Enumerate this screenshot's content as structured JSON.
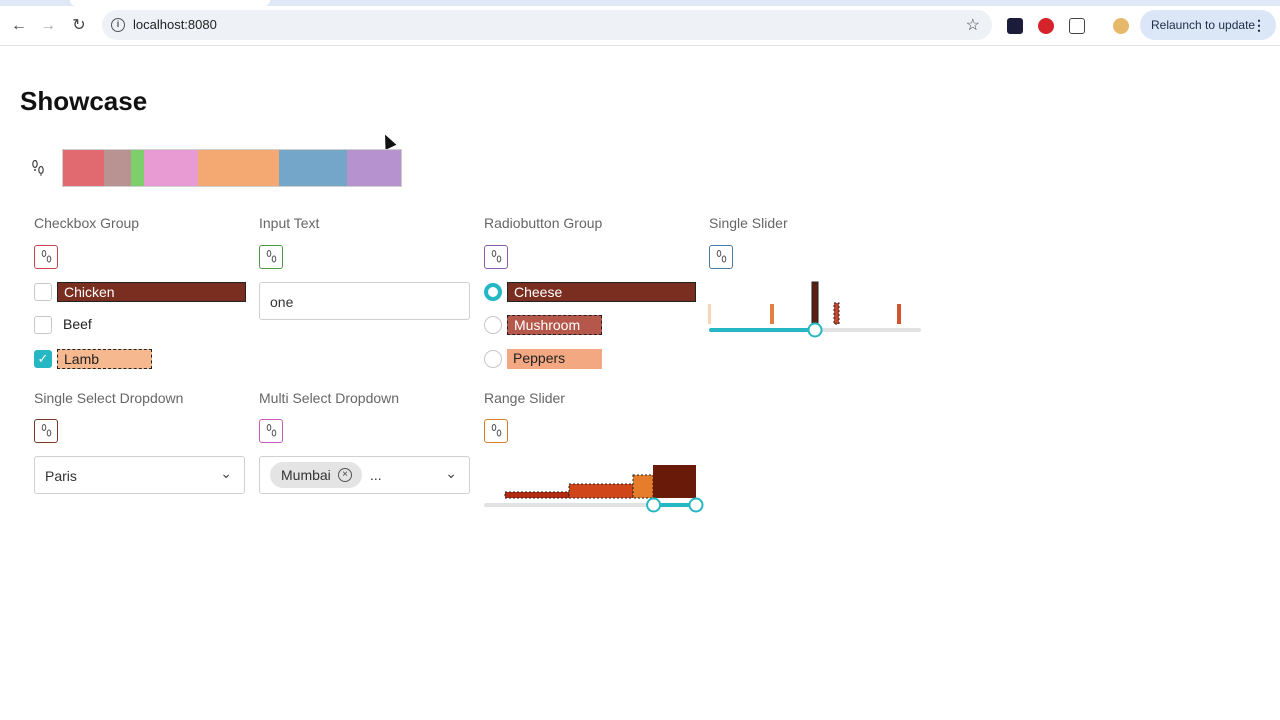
{
  "browser": {
    "url": "localhost:8080",
    "relaunch_label": "Relaunch to update",
    "back_icon": "arrow-left-icon",
    "forward_icon": "arrow-right-icon",
    "reload_icon": "reload-icon"
  },
  "page": {
    "title": "Showcase"
  },
  "palette": {
    "colors": [
      "#e06a6f",
      "#b89391",
      "#7ccf6b",
      "#e89bd3",
      "#f4a872",
      "#74a6c9",
      "#b692cf"
    ]
  },
  "checkbox_group": {
    "label": "Checkbox Group",
    "icon_color": "#c8434e",
    "options": [
      {
        "label": "Chicken",
        "checked": false,
        "highlight": "#7a2e20"
      },
      {
        "label": "Beef",
        "checked": false,
        "highlight": ""
      },
      {
        "label": "Lamb",
        "checked": true,
        "highlight": "#f6b98f"
      }
    ]
  },
  "input_text": {
    "label": "Input Text",
    "icon_color": "#4c9c43",
    "value": "one"
  },
  "radio_group": {
    "label": "Radiobutton Group",
    "icon_color": "#8b5ca8",
    "options": [
      {
        "label": "Cheese",
        "selected": true,
        "highlight": "#7a2e20"
      },
      {
        "label": "Mushroom",
        "selected": false,
        "highlight": "#b5574a"
      },
      {
        "label": "Peppers",
        "selected": false,
        "highlight": "#f4a882"
      }
    ]
  },
  "single_slider": {
    "label": "Single Slider",
    "icon_color": "#4a7aa3",
    "value": 0.5,
    "accent": "#25b8c4"
  },
  "single_select": {
    "label": "Single Select Dropdown",
    "icon_color": "#7a3a2a",
    "value": "Paris"
  },
  "multi_select": {
    "label": "Multi Select Dropdown",
    "icon_color": "#cc5ab8",
    "chip": "Mumbai",
    "more": "..."
  },
  "range_slider": {
    "label": "Range Slider",
    "icon_color": "#d88030",
    "low": 0.8,
    "high": 1.0,
    "accent": "#25b8c4"
  }
}
